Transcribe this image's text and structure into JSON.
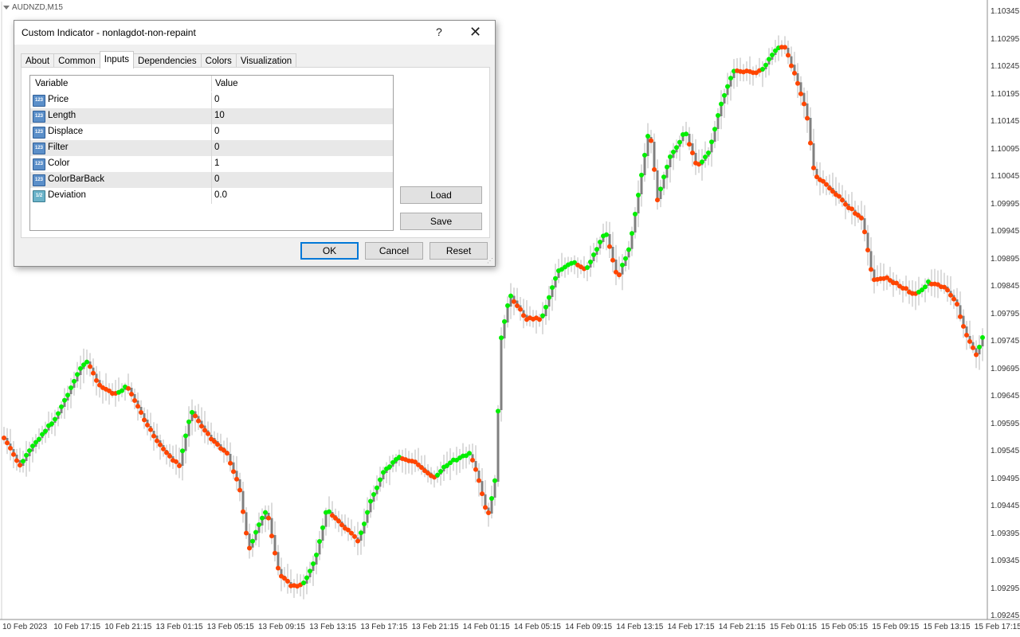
{
  "chart": {
    "symbol": "AUDNZD,M15",
    "price_labels": [
      "1.10345",
      "1.10295",
      "1.10245",
      "1.10195",
      "1.10145",
      "1.10095",
      "1.10045",
      "1.09995",
      "1.09945",
      "1.09895",
      "1.09845",
      "1.09795",
      "1.09745",
      "1.09695",
      "1.09645",
      "1.09595",
      "1.09545",
      "1.09495",
      "1.09445",
      "1.09395",
      "1.09345",
      "1.09295",
      "1.09245"
    ],
    "time_labels": [
      "10 Feb 2023",
      "10 Feb 17:15",
      "10 Feb 21:15",
      "13 Feb 01:15",
      "13 Feb 05:15",
      "13 Feb 09:15",
      "13 Feb 13:15",
      "13 Feb 17:15",
      "13 Feb 21:15",
      "14 Feb 01:15",
      "14 Feb 05:15",
      "14 Feb 09:15",
      "14 Feb 13:15",
      "14 Feb 17:15",
      "14 Feb 21:15",
      "15 Feb 01:15",
      "15 Feb 05:15",
      "15 Feb 09:15",
      "15 Feb 13:15",
      "15 Feb 17:15"
    ],
    "colors": {
      "bar": "#808080",
      "dot_up": "#00ee00",
      "dot_down": "#ff4500"
    }
  },
  "dialog": {
    "title": "Custom Indicator - nonlagdot-non-repaint",
    "help_label": "?",
    "close_label": "✕",
    "tabs": [
      {
        "label": "About"
      },
      {
        "label": "Common"
      },
      {
        "label": "Inputs"
      },
      {
        "label": "Dependencies"
      },
      {
        "label": "Colors"
      },
      {
        "label": "Visualization"
      }
    ],
    "active_tab": "Inputs",
    "table": {
      "header_variable": "Variable",
      "header_value": "Value",
      "rows": [
        {
          "icon": "int-icon",
          "icon_text": "123",
          "name": "Price",
          "value": "0"
        },
        {
          "icon": "int-icon",
          "icon_text": "123",
          "name": "Length",
          "value": "10"
        },
        {
          "icon": "int-icon",
          "icon_text": "123",
          "name": "Displace",
          "value": "0"
        },
        {
          "icon": "int-icon",
          "icon_text": "123",
          "name": "Filter",
          "value": "0"
        },
        {
          "icon": "int-icon",
          "icon_text": "123",
          "name": "Color",
          "value": "1"
        },
        {
          "icon": "int-icon",
          "icon_text": "123",
          "name": "ColorBarBack",
          "value": "0"
        },
        {
          "icon": "double-icon",
          "icon_text": "1/2",
          "name": "Deviation",
          "value": "0.0"
        }
      ]
    },
    "buttons": {
      "load": "Load",
      "save": "Save",
      "ok": "OK",
      "cancel": "Cancel",
      "reset": "Reset"
    }
  }
}
